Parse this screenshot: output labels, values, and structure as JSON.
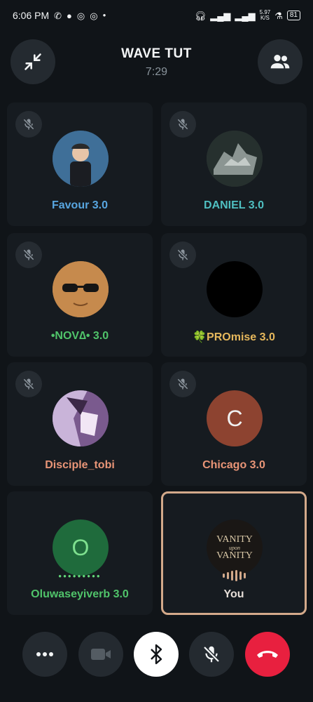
{
  "status_bar": {
    "time": "6:06 PM",
    "net_speed_value": "5.97",
    "net_speed_unit": "K/S",
    "battery": "81"
  },
  "call": {
    "title": "WAVE TUT",
    "duration": "7:29"
  },
  "participants": [
    {
      "name": "Favour 3.0",
      "color": "#58a6e0",
      "muted": true
    },
    {
      "name": "DANIEL 3.0",
      "color": "#4fbfc1",
      "muted": true
    },
    {
      "name": "•NOV∆• 3.0",
      "color": "#50c46a",
      "muted": true
    },
    {
      "name": "🍀PROmise 3.0",
      "color": "#e6b85c",
      "muted": true
    },
    {
      "name": "Disciple_tobi",
      "color": "#e99577",
      "muted": true
    },
    {
      "name": "Chicago 3.0",
      "color": "#e99577",
      "muted": true,
      "initial": "C"
    },
    {
      "name": "Oluwaseyiverb 3.0",
      "color": "#50c46a",
      "muted": false,
      "initial": "O"
    },
    {
      "name": "You",
      "color": "#e6ded8",
      "muted": false
    }
  ],
  "you_avatar_text": {
    "line1": "VANITY",
    "line2": "upon",
    "line3": "VANITY"
  },
  "colors": {
    "end_call": "#e8203f",
    "background": "#101418",
    "tile": "#161b20",
    "active_border": "#d3a98a"
  },
  "icons": {
    "collapse": "collapse-icon",
    "people": "people-icon",
    "more": "more-dots-icon",
    "video": "video-off-icon",
    "bluetooth": "bluetooth-icon",
    "mic": "mic-off-icon",
    "end": "end-call-icon"
  }
}
